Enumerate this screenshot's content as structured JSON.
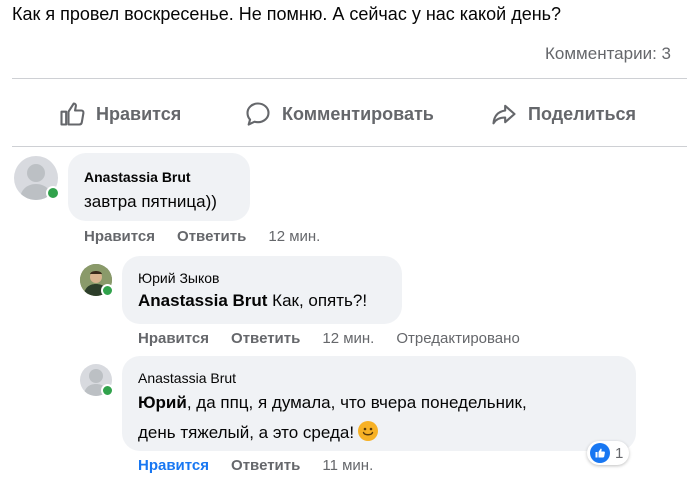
{
  "post": {
    "text": "Как я провел воскресенье. Не помню. А сейчас у нас какой день?",
    "comments_count": "Комментарии: 3"
  },
  "actions": {
    "like": "Нравится",
    "comment": "Комментировать",
    "share": "Поделиться"
  },
  "comments": [
    {
      "author": "Anastassia Brut",
      "text": "завтра пятница))",
      "like": "Нравится",
      "reply": "Ответить",
      "time": "12 мин."
    },
    {
      "author": "Юрий Зыков",
      "mention": "Anastassia Brut",
      "text": " Как, опять?!",
      "like": "Нравится",
      "reply": "Ответить",
      "time": "12 мин.",
      "edited": "Отредактировано"
    },
    {
      "author": "Anastassia Brut",
      "mention": "Юрий",
      "text_line1": ", да ппц, я думала, что вчера понедельник,",
      "text_line2": "день тяжелый, а это среда!",
      "like": "Нравится",
      "reply": "Ответить",
      "time": "11 мин.",
      "reaction_count": "1"
    }
  ],
  "colors": {
    "accent": "#1877f2",
    "secondary_text": "#65676b",
    "bubble": "#f0f2f5",
    "online": "#31a24c"
  },
  "icons": [
    "thumbs-up-icon",
    "comment-icon",
    "share-icon",
    "online-dot-icon",
    "smile-emoji-icon",
    "like-reaction-icon"
  ]
}
